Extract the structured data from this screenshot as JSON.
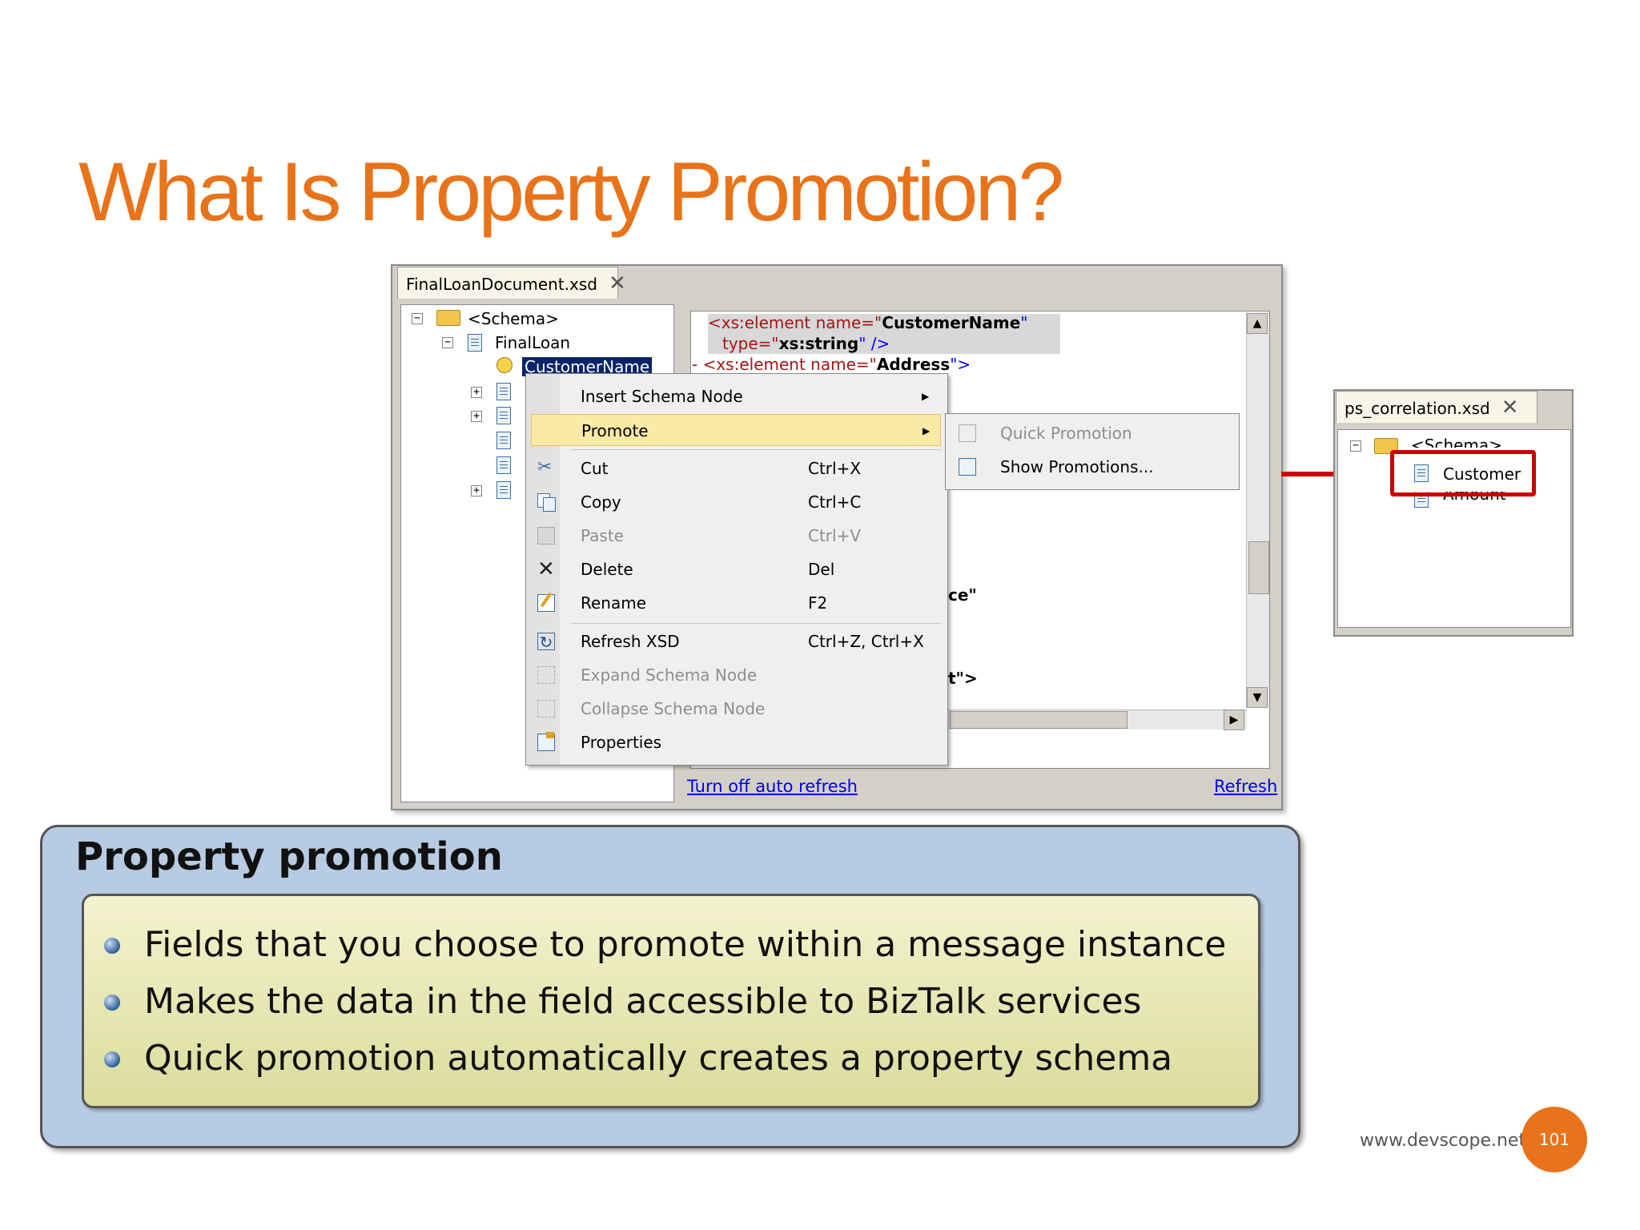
{
  "slide": {
    "title": "What Is Property Promotion?",
    "footer_url": "www.devscope.net",
    "page_number": "101",
    "accent_color": "#E8731A"
  },
  "editor": {
    "tab_title": "FinalLoanDocument.xsd",
    "tab_close": "✕",
    "tree": {
      "schema": "<Schema>",
      "root": "FinalLoan",
      "selected": "CustomerName"
    },
    "code": {
      "line1_tag": "<xs:element name=\"",
      "line1_value": "CustomerName",
      "line1_end": "\"",
      "line2_attr": "type=\"",
      "line2_value": "xs:string",
      "line2_end": "\" />",
      "line3_tag": "- <xs:element name=\"",
      "line3_value": "Address",
      "line3_end": "\">",
      "frag1": "ce\"",
      "frag2": "t\">"
    },
    "links": {
      "auto_refresh": "Turn off auto refresh",
      "refresh": "Refresh"
    }
  },
  "context_menu": {
    "items": [
      {
        "label": "Insert Schema Node",
        "shortcut": "",
        "submenu": true,
        "disabled": false,
        "icon": "none"
      },
      {
        "label": "Promote",
        "shortcut": "",
        "submenu": true,
        "disabled": false,
        "icon": "none"
      },
      {
        "label": "Cut",
        "shortcut": "Ctrl+X",
        "submenu": false,
        "disabled": false,
        "icon": "scissors-icon"
      },
      {
        "label": "Copy",
        "shortcut": "Ctrl+C",
        "submenu": false,
        "disabled": false,
        "icon": "copy-icon"
      },
      {
        "label": "Paste",
        "shortcut": "Ctrl+V",
        "submenu": false,
        "disabled": true,
        "icon": "paste-icon"
      },
      {
        "label": "Delete",
        "shortcut": "Del",
        "submenu": false,
        "disabled": false,
        "icon": "delete-x-icon"
      },
      {
        "label": "Rename",
        "shortcut": "F2",
        "submenu": false,
        "disabled": false,
        "icon": "rename-icon"
      },
      {
        "label": "Refresh XSD",
        "shortcut": "Ctrl+Z, Ctrl+X",
        "submenu": false,
        "disabled": false,
        "icon": "refresh-icon"
      },
      {
        "label": "Expand Schema Node",
        "shortcut": "",
        "submenu": false,
        "disabled": true,
        "icon": "expand-icon"
      },
      {
        "label": "Collapse Schema Node",
        "shortcut": "",
        "submenu": false,
        "disabled": true,
        "icon": "collapse-icon"
      },
      {
        "label": "Properties",
        "shortcut": "",
        "submenu": false,
        "disabled": false,
        "icon": "properties-icon"
      }
    ],
    "submenu": [
      {
        "label": "Quick Promotion",
        "disabled": true
      },
      {
        "label": "Show Promotions...",
        "disabled": false
      }
    ]
  },
  "correlation_window": {
    "tab_title": "ps_correlation.xsd",
    "tab_close": "✕",
    "schema": "<Schema>",
    "fields": [
      "Customer",
      "Amount"
    ],
    "highlight_color": "#cc0000"
  },
  "callout": {
    "heading": "Property promotion",
    "bullets": [
      "Fields that you choose to promote within a message instance",
      "Makes the data in the field accessible to BizTalk services",
      "Quick promotion automatically creates a property schema"
    ]
  }
}
